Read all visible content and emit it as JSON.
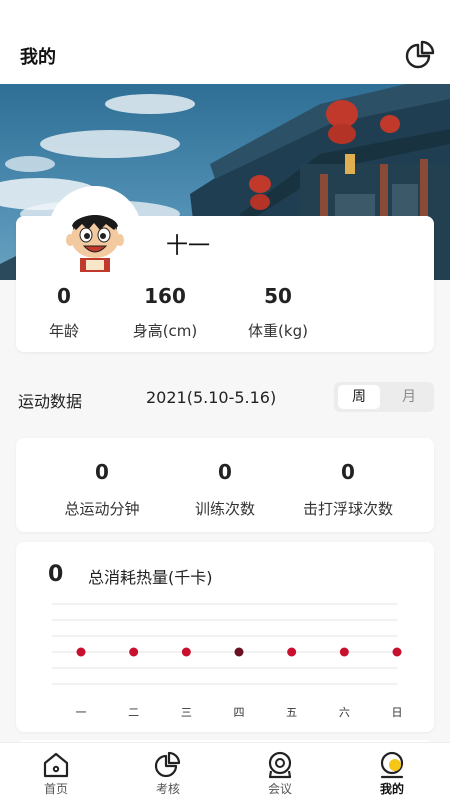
{
  "header": {
    "title": "我的"
  },
  "profile": {
    "nickname": "十一",
    "stats": [
      {
        "value": "0",
        "label": "年龄"
      },
      {
        "value": "160",
        "label": "身高(cm)"
      },
      {
        "value": "50",
        "label": "体重(kg)"
      }
    ]
  },
  "exercise": {
    "title": "运动数据",
    "date_range": "2021(5.10-5.16)",
    "toggle": {
      "week": "周",
      "month": "月",
      "selected": "周"
    },
    "counts": [
      {
        "value": "0",
        "label": "总运动分钟"
      },
      {
        "value": "0",
        "label": "训练次数"
      },
      {
        "value": "0",
        "label": "击打浮球次数"
      }
    ]
  },
  "calories": {
    "value": "0",
    "title": "总消耗热量(千卡)",
    "days": [
      "一",
      "二",
      "三",
      "四",
      "五",
      "六",
      "日"
    ],
    "highlight_index": 3,
    "dot_color": "#c8102e",
    "highlight_color": "#6b1020"
  },
  "tabbar": {
    "items": [
      {
        "label": "首页",
        "icon": "home-icon"
      },
      {
        "label": "考核",
        "icon": "pie-chart-icon"
      },
      {
        "label": "会议",
        "icon": "webcam-icon"
      },
      {
        "label": "我的",
        "icon": "user-icon"
      }
    ],
    "active_index": 3,
    "accent": "#f5c518"
  }
}
